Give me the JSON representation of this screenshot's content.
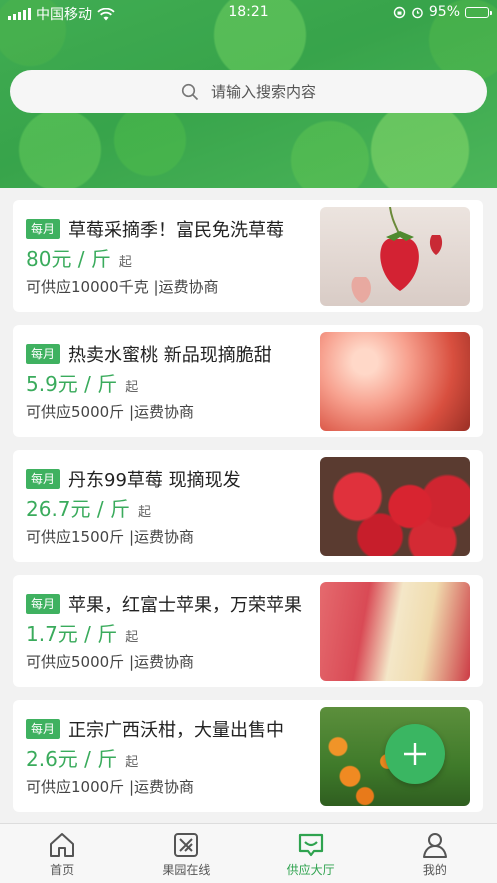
{
  "status_bar": {
    "carrier": "中国移动",
    "time": "18:21",
    "battery": "95%",
    "battery_level": 0.95
  },
  "search": {
    "placeholder": "请输入搜索内容"
  },
  "products": [
    {
      "badge": "每月",
      "title": "草莓采摘季！富民免洗草莓",
      "price": "80元 / 斤",
      "unit_suffix": "起",
      "meta": "可供应10000千克 |运费协商",
      "image": "strawberry-on-vine-image"
    },
    {
      "badge": "每月",
      "title": "热卖水蜜桃 新品现摘脆甜",
      "price": "5.9元 / 斤",
      "unit_suffix": "起",
      "meta": "可供应5000斤 |运费协商",
      "image": "peach-image"
    },
    {
      "badge": "每月",
      "title": "丹东99草莓 现摘现发",
      "price": "26.7元 / 斤",
      "unit_suffix": "起",
      "meta": "可供应1500斤 |运费协商",
      "image": "strawberries-image"
    },
    {
      "badge": "每月",
      "title": "苹果，红富士苹果，万荣苹果",
      "price": "1.7元 / 斤",
      "unit_suffix": "起",
      "meta": "可供应5000斤 |运费协商",
      "image": "apple-image"
    },
    {
      "badge": "每月",
      "title": "正宗广西沃柑，大量出售中",
      "price": "2.6元 / 斤",
      "unit_suffix": "起",
      "meta": "可供应1000斤 |运费协商",
      "image": "orange-tree-image"
    }
  ],
  "tabbar": {
    "items": [
      {
        "label": "首页",
        "icon": "home-icon"
      },
      {
        "label": "果园在线",
        "icon": "orchard-icon"
      },
      {
        "label": "供应大厅",
        "icon": "supply-hall-icon"
      },
      {
        "label": "我的",
        "icon": "profile-icon"
      }
    ],
    "active_index": 2
  },
  "colors": {
    "accent": "#3aab5c",
    "badge": "#3fb160",
    "fab": "#3ab662"
  }
}
